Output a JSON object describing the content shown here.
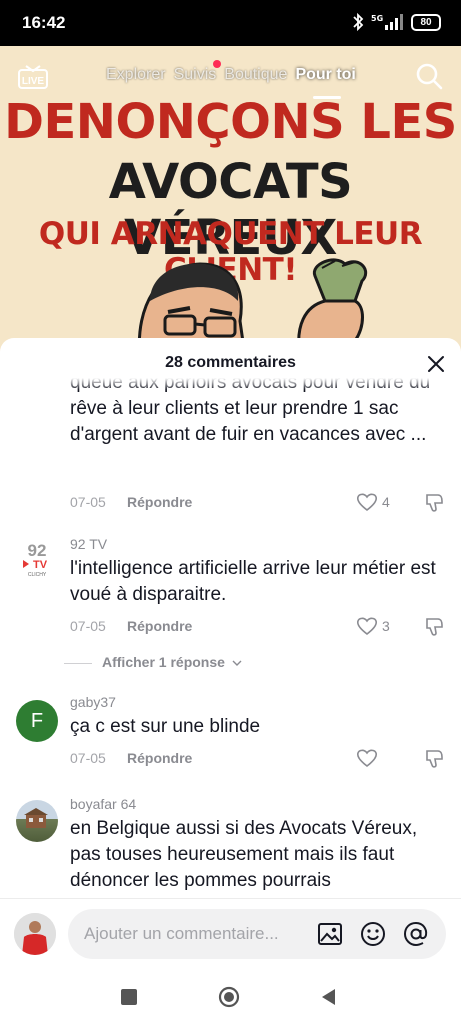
{
  "status": {
    "time": "16:42",
    "network": "5G",
    "battery": "80"
  },
  "nav": {
    "live_label": "LIVE",
    "tabs": [
      {
        "label": "Explorer"
      },
      {
        "label": "Suivis"
      },
      {
        "label": "Boutique"
      },
      {
        "label": "Pour toi"
      }
    ]
  },
  "video": {
    "headline_1": "DENONÇONS LES",
    "headline_2": "AVOCATS VÉREUX",
    "headline_3": "QUI ARNAQUENT LEUR CLIENT!"
  },
  "comments_panel": {
    "title": "28 commentaires",
    "reply_label": "Répondre",
    "comments": [
      {
        "user": "",
        "text": "c'est les débuts de vacances ils font la queue aux parloirs avocats pour vendre du rêve à leur clients et leur prendre 1 sac d'argent avant de fuir en vacances avec ...",
        "date": "07-05",
        "likes": "4"
      },
      {
        "user": "92 TV",
        "avatar_text": "92",
        "avatar_sub": "TV",
        "avatar_caption": "CLICHY",
        "text": "l'intelligence artificielle arrive leur métier est voué à disparaitre.",
        "date": "07-05",
        "likes": "3",
        "replies_label": "Afficher 1 réponse"
      },
      {
        "user": "gaby37",
        "avatar_letter": "F",
        "text": "ça c est sur une blinde",
        "date": "07-05",
        "likes": ""
      },
      {
        "user": "boyafar 64",
        "text": "en Belgique aussi si des Avocats Véreux, pas touses heureusement mais ils faut dénoncer les pommes pourrais",
        "date": "",
        "likes": ""
      }
    ]
  },
  "input": {
    "placeholder": "Ajouter un commentaire..."
  },
  "colors": {
    "accent": "#fe2c55",
    "headline_red": "#c0291f",
    "avatar_green": "#2e7d32"
  }
}
